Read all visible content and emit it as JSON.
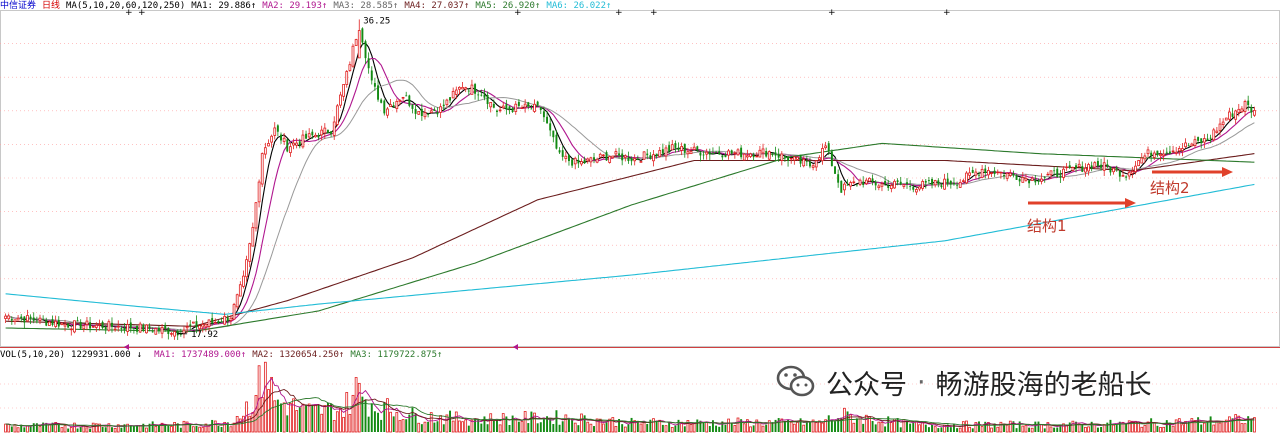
{
  "header": {
    "stock_name": "中信证券",
    "period": "日线",
    "ma_params": "MA(5,10,20,60,120,250)",
    "ma_values": [
      {
        "label": "MA1:",
        "value": "29.886",
        "arrow": "↑",
        "color": "#000000"
      },
      {
        "label": "MA2:",
        "value": "29.193",
        "arrow": "↑",
        "color": "#b0178f"
      },
      {
        "label": "MA3:",
        "value": "28.585",
        "arrow": "↑",
        "color": "#666666"
      },
      {
        "label": "MA4:",
        "value": "27.037",
        "arrow": "↑",
        "color": "#6b1d1d"
      },
      {
        "label": "MA5:",
        "value": "26.920",
        "arrow": "↑",
        "color": "#2d7a2d"
      },
      {
        "label": "MA6:",
        "value": "26.022",
        "arrow": "↑",
        "color": "#22bcd6"
      }
    ]
  },
  "volume_header": {
    "params": "VOL(5,10,20)",
    "value": "1229931.000",
    "value_arrow": "↓",
    "ma_values": [
      {
        "label": "MA1:",
        "value": "1737489.000",
        "arrow": "↑",
        "color": "#b0178f"
      },
      {
        "label": "MA2:",
        "value": "1320654.250",
        "arrow": "↑",
        "color": "#6b1d1d"
      },
      {
        "label": "MA3:",
        "value": "1179722.875",
        "arrow": "↑",
        "color": "#2d7a2d"
      }
    ]
  },
  "annotations": {
    "high_label": "36.25",
    "low_label": "17.92",
    "structure1": "结构1",
    "structure2": "结构2"
  },
  "watermark": {
    "account": "公众号",
    "separator": "·",
    "name": "畅游股海的老船长"
  },
  "colors": {
    "up": "#e02020",
    "down": "#138a13",
    "grid": "#ff9e9e",
    "arrow": "#e0402a"
  },
  "chart_data": {
    "type": "candlestick",
    "price_range": [
      17.5,
      36.8
    ],
    "high": 36.25,
    "low": 17.92,
    "anchors": [
      [
        0,
        18.9
      ],
      [
        20,
        18.4
      ],
      [
        40,
        18.25
      ],
      [
        55,
        18.0
      ],
      [
        60,
        18.3
      ],
      [
        68,
        18.6
      ],
      [
        72,
        18.9
      ],
      [
        76,
        21.0
      ],
      [
        79,
        24.0
      ],
      [
        82,
        28.5
      ],
      [
        86,
        29.8
      ],
      [
        90,
        28.8
      ],
      [
        96,
        29.3
      ],
      [
        104,
        29.8
      ],
      [
        109,
        33.0
      ],
      [
        113,
        36.0
      ],
      [
        117,
        32.5
      ],
      [
        121,
        31.0
      ],
      [
        127,
        31.8
      ],
      [
        132,
        30.8
      ],
      [
        139,
        31.0
      ],
      [
        146,
        32.4
      ],
      [
        152,
        32.0
      ],
      [
        157,
        30.9
      ],
      [
        164,
        31.1
      ],
      [
        171,
        31.0
      ],
      [
        177,
        28.2
      ],
      [
        183,
        27.8
      ],
      [
        193,
        28.3
      ],
      [
        201,
        28.1
      ],
      [
        213,
        28.7
      ],
      [
        223,
        28.5
      ],
      [
        234,
        28.4
      ],
      [
        244,
        28.5
      ],
      [
        252,
        28.0
      ],
      [
        257,
        27.7
      ],
      [
        262,
        28.8
      ],
      [
        267,
        26.3
      ],
      [
        273,
        26.8
      ],
      [
        279,
        26.6
      ],
      [
        285,
        26.6
      ],
      [
        291,
        26.5
      ],
      [
        305,
        26.8
      ],
      [
        312,
        27.5
      ],
      [
        320,
        27.2
      ],
      [
        328,
        26.9
      ],
      [
        338,
        27.3
      ],
      [
        348,
        27.8
      ],
      [
        358,
        27.2
      ],
      [
        362,
        28.0
      ],
      [
        366,
        28.5
      ],
      [
        372,
        28.6
      ],
      [
        380,
        29.0
      ],
      [
        384,
        29.2
      ],
      [
        390,
        30.5
      ],
      [
        396,
        31.3
      ],
      [
        399,
        30.8
      ]
    ],
    "volume_anchors": [
      [
        0,
        0.6
      ],
      [
        60,
        0.7
      ],
      [
        72,
        1.0
      ],
      [
        76,
        2.0
      ],
      [
        80,
        3.5
      ],
      [
        83,
        6.0
      ],
      [
        86,
        3.0
      ],
      [
        96,
        2.0
      ],
      [
        108,
        2.2
      ],
      [
        112,
        4.0
      ],
      [
        118,
        2.5
      ],
      [
        130,
        1.6
      ],
      [
        150,
        1.2
      ],
      [
        177,
        1.4
      ],
      [
        200,
        0.9
      ],
      [
        260,
        0.9
      ],
      [
        267,
        1.6
      ],
      [
        290,
        0.7
      ],
      [
        340,
        0.7
      ],
      [
        370,
        0.9
      ],
      [
        399,
        1.2
      ]
    ]
  }
}
